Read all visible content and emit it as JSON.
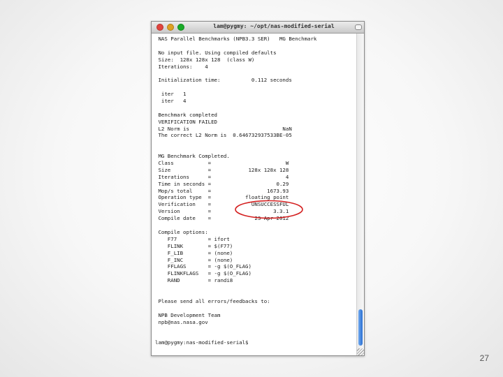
{
  "window": {
    "title": "lam@pygmy: ~/opt/nas-modified-serial"
  },
  "terminal": {
    "lines": [
      " NAS Parallel Benchmarks (NPB3.3 SER)   MG Benchmark",
      "",
      " No input file. Using compiled defaults",
      " Size:  128x 128x 128  (class W)",
      " Iterations:    4",
      "",
      " Initialization time:          0.112 seconds",
      "",
      "  iter   1",
      "  iter   4",
      "",
      " Benchmark completed",
      " VERIFICATION FAILED",
      " L2 Norm is                              NaN",
      " The correct L2 Norm is  0.646732937533BE-05",
      "",
      "",
      " MG Benchmark Completed.",
      " Class           =                        W",
      " Size            =            128x 128x 128",
      " Iterations      =                        4",
      " Time in seconds =                     0.29",
      " Mop/s total     =                  1673.93",
      " Operation type  =           floating point",
      " Verification    =             UNSUCCESSFUL",
      " Version         =                    3.3.1",
      " Compile date    =              23 Apr 2012",
      "",
      " Compile options:",
      "    F77          = ifort",
      "    FLINK        = $(F77)",
      "    F_LIB        = (none)",
      "    F_INC        = (none)",
      "    FFLAGS       = -g $(O_FLAG)",
      "    FLINKFLAGS   = -g $(O_FLAG)",
      "    RAND         = randi8",
      "",
      "",
      " Please send all errors/feedbacks to:",
      "",
      " NPB Development Team",
      " npb@nas.nasa.gov",
      "",
      "",
      "lam@pygmy:nas-modified-serial$"
    ]
  },
  "annotation": {
    "color": "#d42020"
  },
  "slide": {
    "number": "27"
  }
}
